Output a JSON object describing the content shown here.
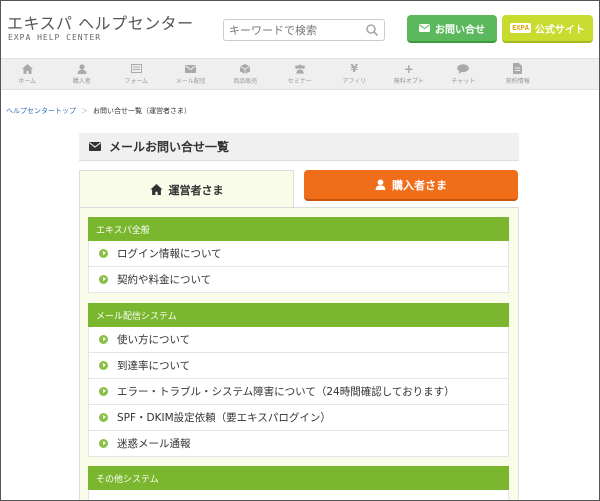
{
  "header": {
    "logo_title": "エキスパ ヘルプセンター",
    "logo_sub_brand": "EXPA",
    "logo_sub_text": "HELP CENTER",
    "search_placeholder": "キーワードで検索",
    "contact_button": "お問い合せ",
    "official_badge": "EXPA",
    "official_button": "公式サイト"
  },
  "nav": [
    {
      "label": "ホーム",
      "icon": "home-icon"
    },
    {
      "label": "購入者",
      "icon": "user-icon"
    },
    {
      "label": "フォーム",
      "icon": "form-icon"
    },
    {
      "label": "メール配信",
      "icon": "envelope-icon"
    },
    {
      "label": "商品販売",
      "icon": "box-icon"
    },
    {
      "label": "セミナー",
      "icon": "group-icon"
    },
    {
      "label": "アフィリ",
      "icon": "yen-icon"
    },
    {
      "label": "無料オプト",
      "icon": "plus-icon"
    },
    {
      "label": "チャット",
      "icon": "chat-icon"
    },
    {
      "label": "契約情報",
      "icon": "document-icon"
    }
  ],
  "breadcrumb": {
    "home": "ヘルプセンタートップ",
    "separator": "＞",
    "current": "お問い合せ一覧（運営者さま）"
  },
  "page_title": "メールお問い合せ一覧",
  "tabs": {
    "owner": "運営者さま",
    "buyer": "購入者さま"
  },
  "sections": [
    {
      "title": "エキスパ全般",
      "items": [
        "ログイン情報について",
        "契約や料金について"
      ]
    },
    {
      "title": "メール配信システム",
      "items": [
        "使い方について",
        "到達率について",
        "エラー・トラブル・システム障害について（24時間確認しております）",
        "SPF・DKIM設定依頼（要エキスパログイン）",
        "迷惑メール通報"
      ]
    },
    {
      "title": "その他システム",
      "items": []
    }
  ],
  "colors": {
    "contact_green": "#5cb85c",
    "official_lime": "#c7dc2e",
    "buyer_orange": "#f06d1a",
    "section_green": "#7ab72f",
    "panel_bg": "#fafcea"
  }
}
